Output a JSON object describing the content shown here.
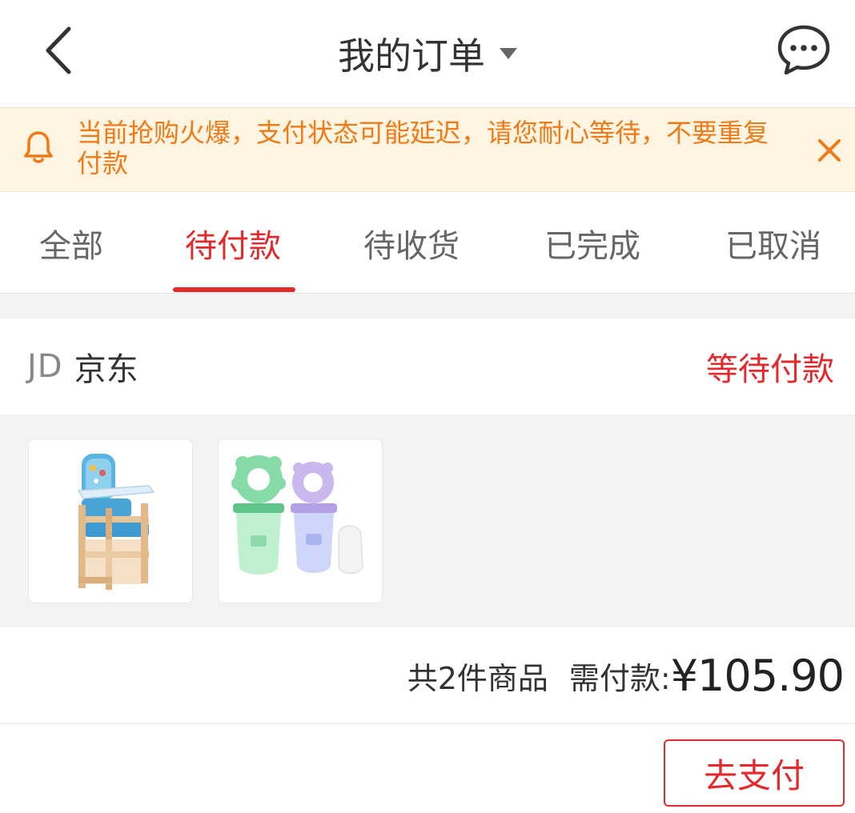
{
  "header": {
    "title": "我的订单",
    "back_icon": "chevron-left-icon",
    "dropdown_icon": "caret-down-icon",
    "message_icon": "chat-bubble-icon"
  },
  "notice": {
    "icon": "bell-icon",
    "text": "当前抢购火爆，支付状态可能延迟，请您耐心等待，不要重复付款",
    "close_icon": "close-icon",
    "color": "#f07a17",
    "background": "#fdf5e1"
  },
  "tabs": [
    {
      "label": "全部",
      "active": false
    },
    {
      "label": "待付款",
      "active": true
    },
    {
      "label": "待收货",
      "active": false
    },
    {
      "label": "已完成",
      "active": false
    },
    {
      "label": "已取消",
      "active": false
    }
  ],
  "order": {
    "shop_logo": "JD",
    "shop_name": "京东",
    "status": "等待付款",
    "products": [
      {
        "name": "high-chair-product-image"
      },
      {
        "name": "fruit-feeder-product-image"
      }
    ],
    "item_count": "共2件商品",
    "pay_label": "需付款:",
    "amount": "¥105.90",
    "pay_button": "去支付"
  },
  "colors": {
    "accent": "#e3292c",
    "text": "#333333",
    "muted": "#666666",
    "divider_bg": "#f2f3f5"
  }
}
